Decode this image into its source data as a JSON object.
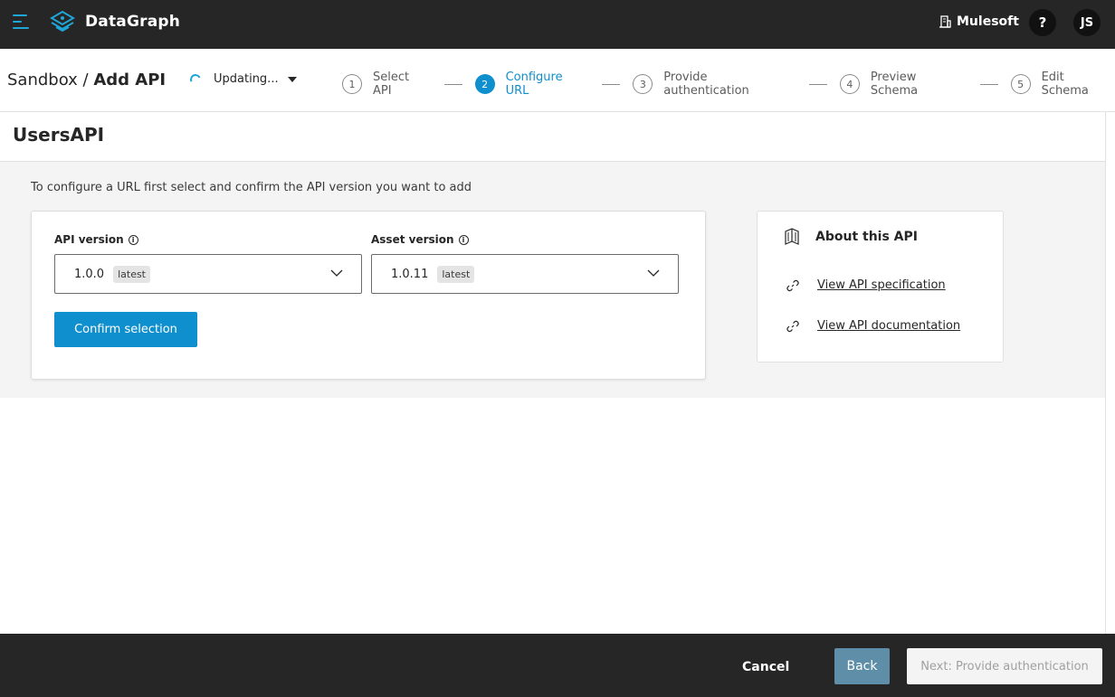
{
  "header": {
    "app_name": "DataGraph",
    "org_name": "Mulesoft",
    "help_label": "?",
    "user_initials": "JS"
  },
  "breadcrumb": {
    "parent": "Sandbox",
    "separator": " / ",
    "current": "Add API"
  },
  "status": {
    "label": "Updating..."
  },
  "steps": [
    {
      "number": "1",
      "label": "Select API",
      "active": false
    },
    {
      "number": "2",
      "label": "Configure URL",
      "active": true
    },
    {
      "number": "3",
      "label": "Provide authentication",
      "active": false
    },
    {
      "number": "4",
      "label": "Preview Schema",
      "active": false
    },
    {
      "number": "5",
      "label": "Edit Schema",
      "active": false
    }
  ],
  "page": {
    "title": "UsersAPI",
    "instructions": "To configure a URL first select and confirm the API version you want to add"
  },
  "form": {
    "api_version": {
      "label": "API version",
      "value": "1.0.0",
      "badge": "latest"
    },
    "asset_version": {
      "label": "Asset version",
      "value": "1.0.11",
      "badge": "latest"
    },
    "confirm_label": "Confirm selection"
  },
  "about": {
    "title": "About this API",
    "links": [
      {
        "label": "View API specification"
      },
      {
        "label": "View API documentation"
      }
    ]
  },
  "footer": {
    "cancel_label": "Cancel",
    "back_label": "Back",
    "next_label": "Next: Provide authentication"
  },
  "colors": {
    "accent": "#0f8fce",
    "topbar": "#262626",
    "back_button": "#5f8fa8"
  }
}
